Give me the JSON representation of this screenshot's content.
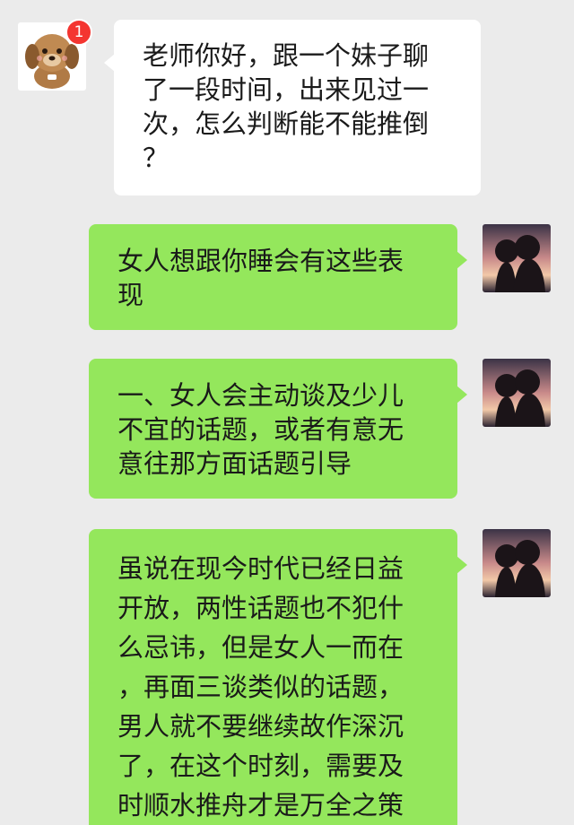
{
  "chat": {
    "contact": {
      "avatar_icon": "puppy-avatar-icon",
      "unread_badge": "1"
    },
    "self": {
      "avatar_icon": "couple-silhouette-avatar-icon"
    },
    "messages": [
      {
        "sender": "contact",
        "lines": [
          "老师你好，跟一个妹子聊",
          "了一段时间，出来见过一",
          "次，怎么判断能不能推倒",
          "？"
        ]
      },
      {
        "sender": "self",
        "lines": [
          "女人想跟你睡会有这些表",
          "现"
        ]
      },
      {
        "sender": "self",
        "lines": [
          "一、女人会主动谈及少儿",
          "不宜的话题，或者有意无",
          "意往那方面话题引导"
        ]
      },
      {
        "sender": "self",
        "lines": [
          "虽说在现今时代已经日益",
          "开放，两性话题也不犯什",
          "么忌讳，但是女人一而在",
          "，再面三谈类似的话题，",
          "男人就不要继续故作深沉",
          "了，在这个时刻，需要及",
          "时顺水推舟才是万全之策"
        ]
      }
    ]
  },
  "colors": {
    "background": "#ebebeb",
    "incoming_bubble": "#ffffff",
    "outgoing_bubble": "#94e75c",
    "badge": "#f43530"
  }
}
